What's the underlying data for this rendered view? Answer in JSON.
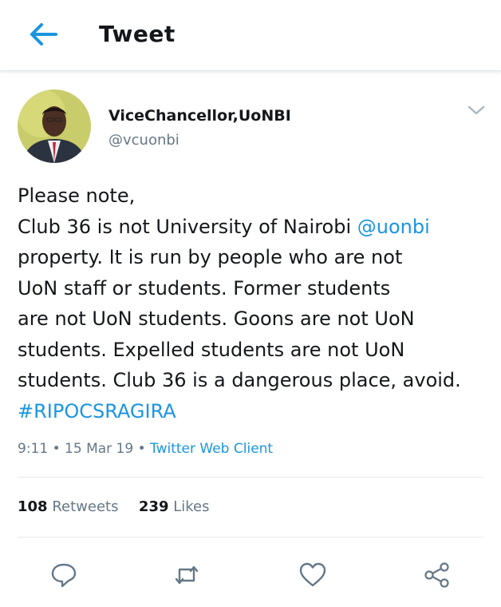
{
  "header": {
    "title": "Tweet",
    "back_icon": "arrow-left-icon"
  },
  "tweet": {
    "author_name": "ViceChancellor,UoNBI",
    "author_handle": "@vcuonbi",
    "text_1": "Please note,\nClub 36 is not University of Nairobi ",
    "mention": "@uonbi",
    "text_2": "\nproperty. It is run by people who are not\nUoN staff or students. Former students\nare not UoN students. Goons are not UoN\nstudents. Expelled students are not UoN\nstudents. Club 36 is a dangerous place, avoid.\n",
    "hashtag": "#RIPOCSRAGIRA",
    "time": "9:11",
    "date": "15 Mar 19",
    "client": "Twitter Web Client",
    "retweet_count": "108",
    "retweet_label": "Retweets",
    "like_count": "239",
    "like_label": "Likes"
  },
  "actions": [
    "reply-icon",
    "retweet-icon",
    "like-icon",
    "share-icon"
  ],
  "colors": {
    "accent": "#1b95e0",
    "text": "#14171a",
    "secondary": "#657786"
  }
}
